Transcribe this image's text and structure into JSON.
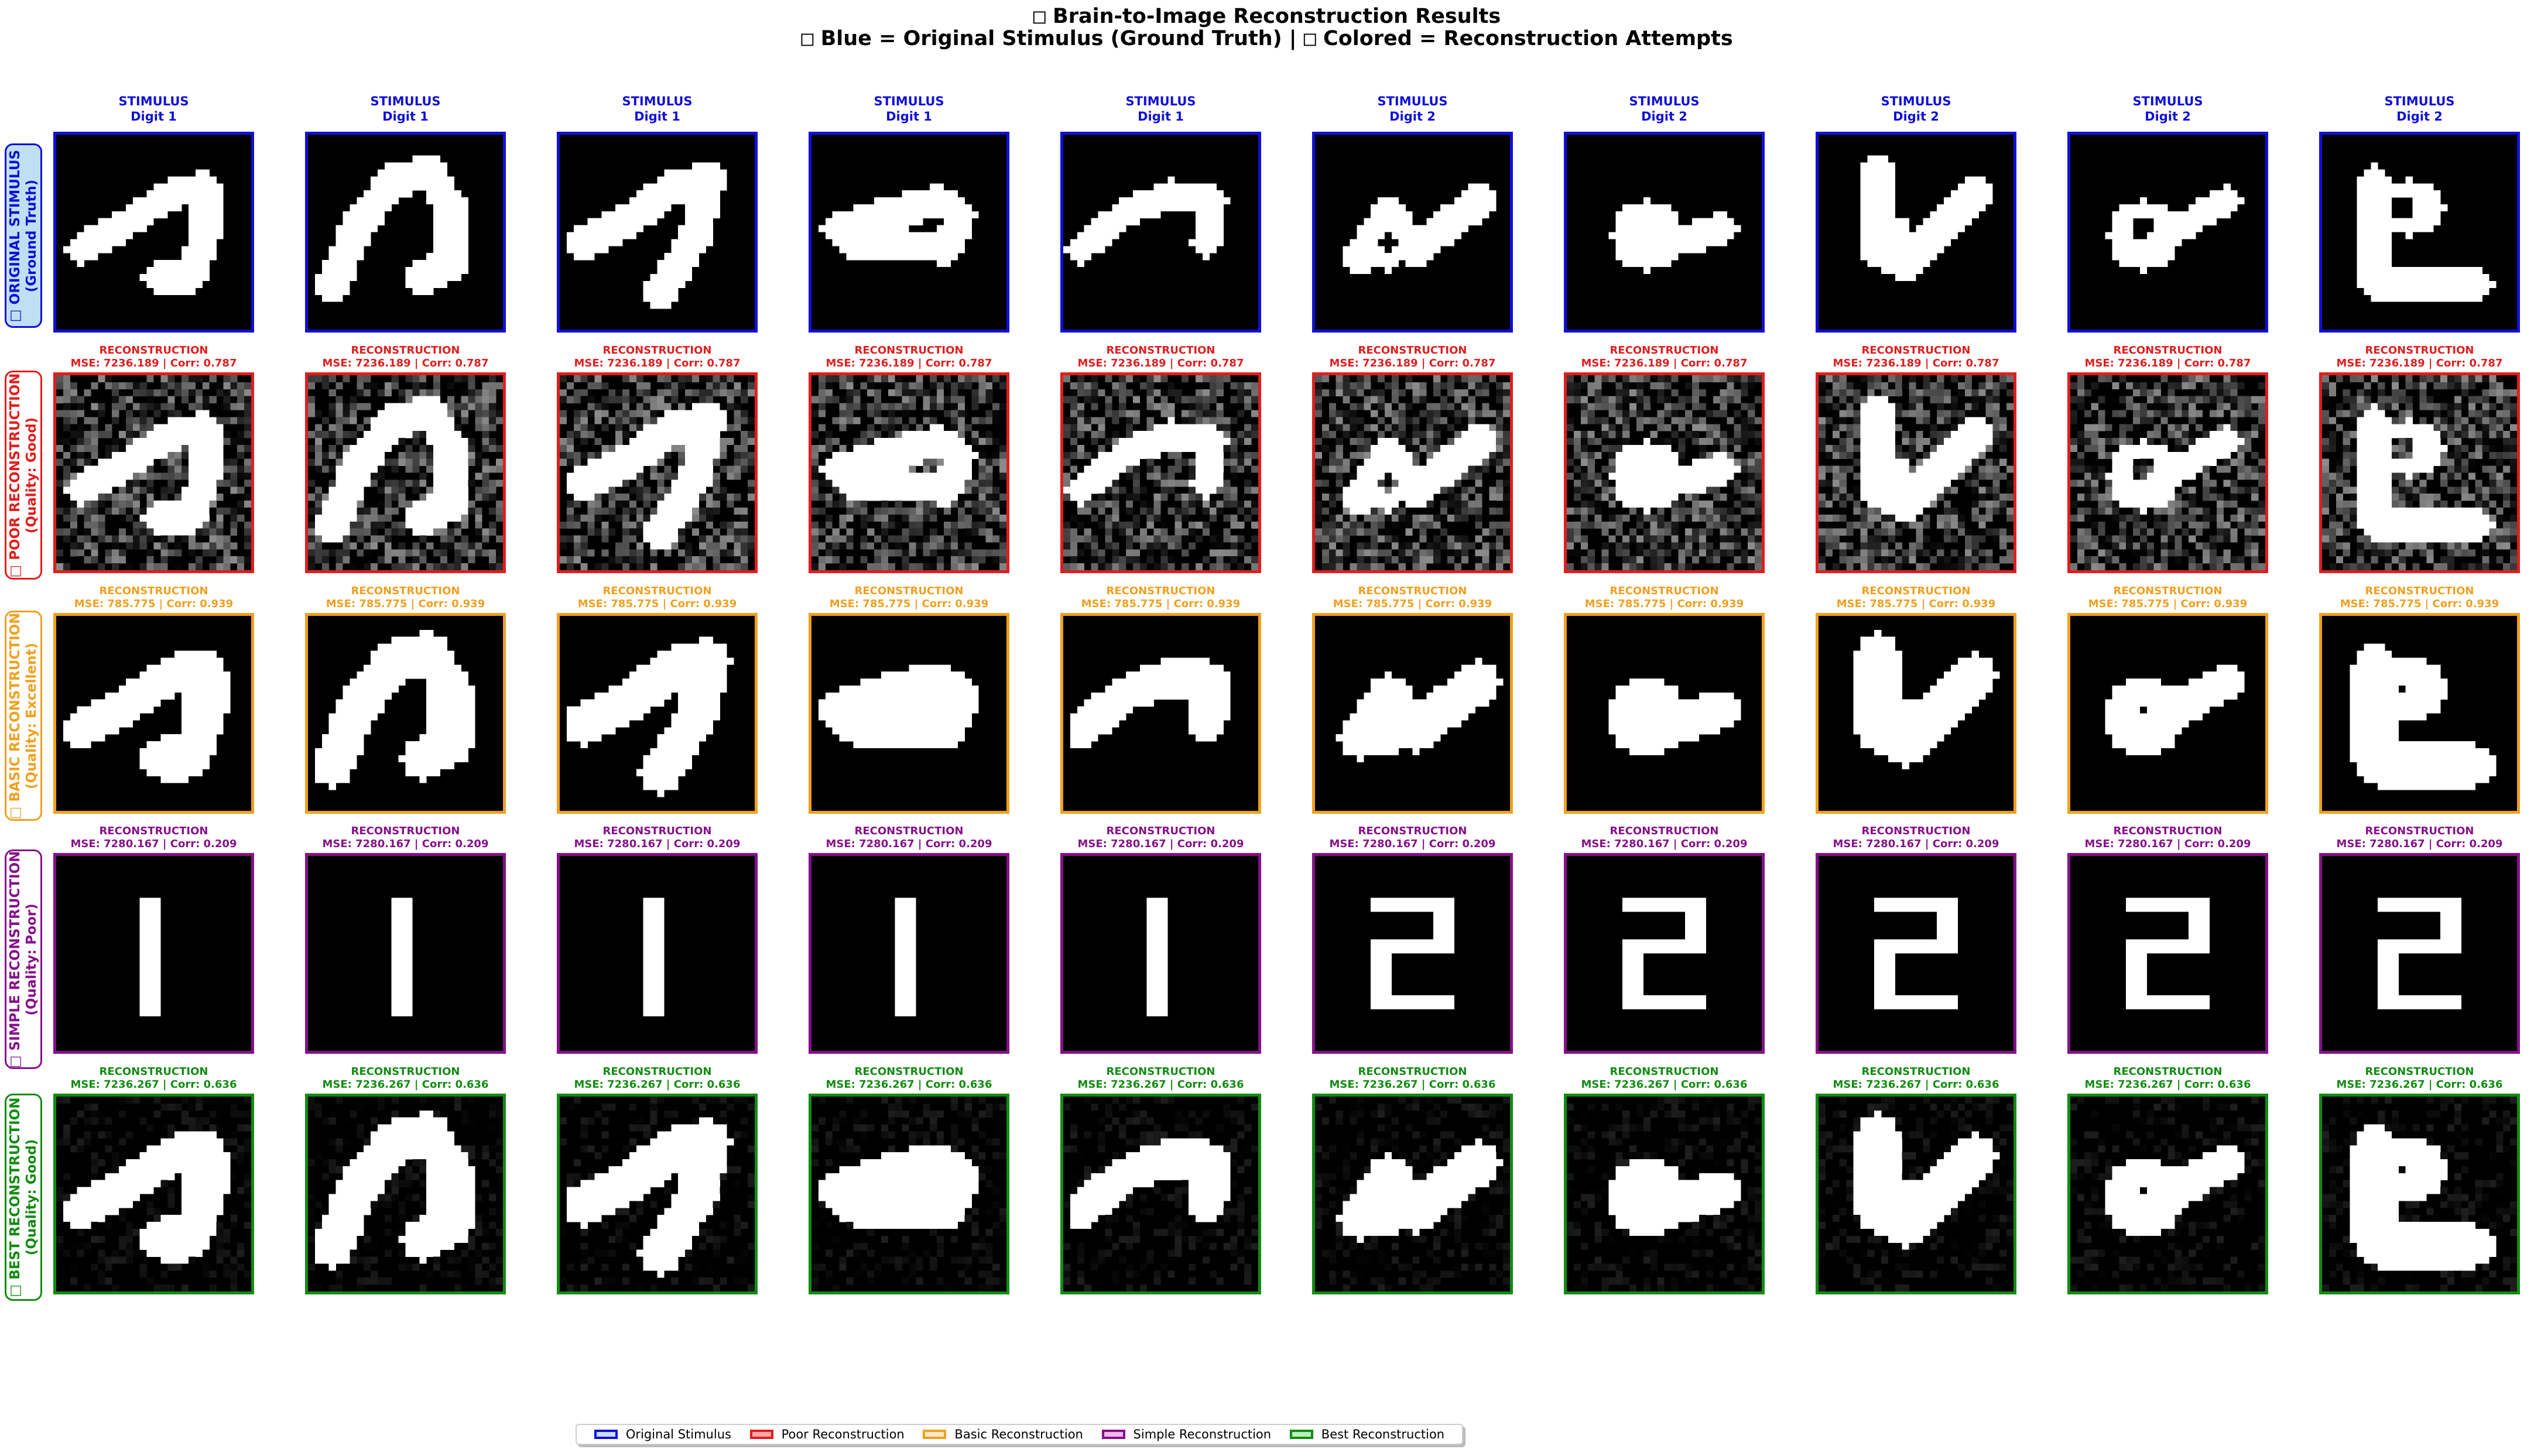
{
  "figure": {
    "title_icon": "□",
    "title": "Brain-to-Image Reconstruction Results",
    "subtitle_part1": "Blue = Original Stimulus (Ground Truth) |",
    "subtitle_part2": "Colored = Reconstruction Attempts"
  },
  "columns": [
    {
      "l1": "STIMULUS",
      "l2": "Digit 1"
    },
    {
      "l1": "STIMULUS",
      "l2": "Digit 1"
    },
    {
      "l1": "STIMULUS",
      "l2": "Digit 1"
    },
    {
      "l1": "STIMULUS",
      "l2": "Digit 1"
    },
    {
      "l1": "STIMULUS",
      "l2": "Digit 1"
    },
    {
      "l1": "STIMULUS",
      "l2": "Digit 2"
    },
    {
      "l1": "STIMULUS",
      "l2": "Digit 2"
    },
    {
      "l1": "STIMULUS",
      "l2": "Digit 2"
    },
    {
      "l1": "STIMULUS",
      "l2": "Digit 2"
    },
    {
      "l1": "STIMULUS",
      "l2": "Digit 2"
    }
  ],
  "rows": [
    {
      "key": "original",
      "label1": "□ ORIGINAL STIMULUS",
      "label2": "(Ground Truth)",
      "color": "#1010d8",
      "bg": "#bfe0f2",
      "cell_title": "",
      "cell_metrics": ""
    },
    {
      "key": "poor",
      "label1": "□ POOR RECONSTRUCTION",
      "label2": "(Quality: Good)",
      "color": "#e01e1e",
      "bg": "#ffffff",
      "cell_title": "RECONSTRUCTION",
      "cell_metrics": "MSE: 7236.189 | Corr: 0.787"
    },
    {
      "key": "basic",
      "label1": "□ BASIC RECONSTRUCTION",
      "label2": "(Quality: Excellent)",
      "color": "#f0a020",
      "bg": "#ffffff",
      "cell_title": "RECONSTRUCTION",
      "cell_metrics": "MSE: 785.775 | Corr: 0.939"
    },
    {
      "key": "simple",
      "label1": "□ SIMPLE RECONSTRUCTION",
      "label2": "(Quality: Poor)",
      "color": "#86108a",
      "bg": "#ffffff",
      "cell_title": "RECONSTRUCTION",
      "cell_metrics": "MSE: 7280.167 | Corr: 0.209"
    },
    {
      "key": "best",
      "label1": "□ BEST RECONSTRUCTION",
      "label2": "(Quality: Good)",
      "color": "#128c12",
      "bg": "#ffffff",
      "cell_title": "RECONSTRUCTION",
      "cell_metrics": "MSE: 7236.267 | Corr: 0.636"
    }
  ],
  "legend": [
    {
      "label": "Original Stimulus",
      "border": "#1010d8",
      "fill": "#c8dcf8"
    },
    {
      "label": "Poor Reconstruction",
      "border": "#e01e1e",
      "fill": "#f8a8a8"
    },
    {
      "label": "Basic Reconstruction",
      "border": "#f0a020",
      "fill": "#fce8c8"
    },
    {
      "label": "Simple Reconstruction",
      "border": "#86108a",
      "fill": "#f0b8f0"
    },
    {
      "label": "Best Reconstruction",
      "border": "#128c12",
      "fill": "#b8f0b8"
    }
  ]
}
